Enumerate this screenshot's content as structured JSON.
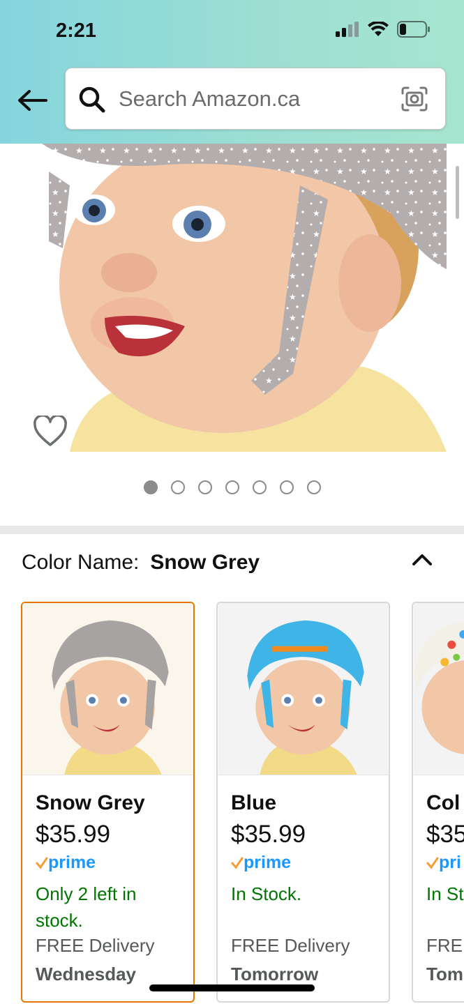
{
  "status_bar": {
    "time": "2:21"
  },
  "search": {
    "placeholder": "Search Amazon.ca"
  },
  "gallery": {
    "total_images": 7,
    "active_index": 0
  },
  "color_section": {
    "label": "Color Name:",
    "selected_value": "Snow Grey"
  },
  "variants": [
    {
      "name": "Snow Grey",
      "price": "$35.99",
      "prime": "prime",
      "stock": "Only 2 left in stock.",
      "delivery_label": "FREE Delivery",
      "delivery_day": "Wednesday",
      "helmet_color": "#a8a3a3",
      "selected": true
    },
    {
      "name": "Blue",
      "price": "$35.99",
      "prime": "prime",
      "stock": "In Stock.",
      "delivery_label": "FREE Delivery",
      "delivery_day": "Tomorrow",
      "helmet_color": "#3fb4e6",
      "selected": false
    },
    {
      "name": "Col",
      "price": "$35",
      "prime": "pri",
      "stock": "In St",
      "delivery_label": "FREE",
      "delivery_day": "Tom",
      "helmet_color": "#f3f0e8",
      "selected": false
    }
  ],
  "colors": {
    "accent_selected": "#e77600",
    "stock_green": "#007600",
    "prime_blue": "#1a98ff",
    "prime_check": "#f79c34"
  }
}
